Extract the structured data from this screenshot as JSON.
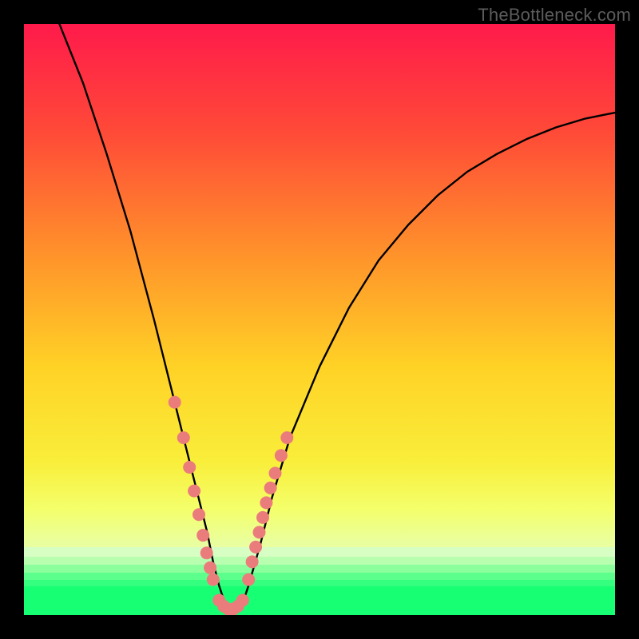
{
  "watermark": "TheBottleneck.com",
  "chart_data": {
    "type": "line",
    "title": "",
    "xlabel": "",
    "ylabel": "",
    "xlim": [
      0,
      100
    ],
    "ylim": [
      0,
      100
    ],
    "series": [
      {
        "name": "bottleneck-curve",
        "x": [
          6,
          10,
          14,
          18,
          22,
          25,
          27,
          29,
          31,
          32,
          33,
          34,
          35,
          36,
          37,
          38,
          40,
          42,
          45,
          50,
          55,
          60,
          65,
          70,
          75,
          80,
          85,
          90,
          95,
          100
        ],
        "y": [
          100,
          90,
          78,
          65,
          50,
          38,
          30,
          22,
          14,
          9,
          5,
          2,
          1,
          1,
          2,
          5,
          12,
          20,
          30,
          42,
          52,
          60,
          66,
          71,
          75,
          78,
          80.5,
          82.5,
          84,
          85
        ]
      },
      {
        "name": "highlight-dots-left",
        "x": [
          25.5,
          27,
          28,
          28.8,
          29.6,
          30.3,
          30.9,
          31.5,
          32
        ],
        "y": [
          36,
          30,
          25,
          21,
          17,
          13.5,
          10.5,
          8,
          6
        ]
      },
      {
        "name": "highlight-dots-right",
        "x": [
          38,
          38.6,
          39.2,
          39.8,
          40.4,
          41,
          41.7,
          42.5,
          43.5,
          44.5
        ],
        "y": [
          6,
          9,
          11.5,
          14,
          16.5,
          19,
          21.5,
          24,
          27,
          30
        ]
      },
      {
        "name": "highlight-dots-bottom",
        "x": [
          33,
          33.8,
          34.6,
          35.4,
          36.2,
          37
        ],
        "y": [
          2.5,
          1.5,
          1,
          1,
          1.5,
          2.5
        ]
      }
    ],
    "gradient_stops": [
      {
        "pct": 0,
        "color": "#ff1a4b"
      },
      {
        "pct": 18,
        "color": "#ff4938"
      },
      {
        "pct": 38,
        "color": "#ff8f2b"
      },
      {
        "pct": 58,
        "color": "#ffd226"
      },
      {
        "pct": 74,
        "color": "#f9ee3a"
      },
      {
        "pct": 82,
        "color": "#f4ff6a"
      },
      {
        "pct": 88,
        "color": "#e9ffa0"
      },
      {
        "pct": 100,
        "color": "#e9ffa0"
      }
    ],
    "green_bands": [
      {
        "top_pct": 88.5,
        "height_pct": 1.6,
        "color": "#d7ffc3"
      },
      {
        "top_pct": 90.1,
        "height_pct": 1.4,
        "color": "#b8ffb0"
      },
      {
        "top_pct": 91.5,
        "height_pct": 1.3,
        "color": "#8cff9d"
      },
      {
        "top_pct": 92.8,
        "height_pct": 1.2,
        "color": "#5dff8c"
      },
      {
        "top_pct": 94.0,
        "height_pct": 1.2,
        "color": "#35ff7e"
      },
      {
        "top_pct": 95.2,
        "height_pct": 4.8,
        "color": "#17ff73"
      }
    ],
    "dot_color": "#eb7c7c",
    "curve_color": "#000000"
  }
}
